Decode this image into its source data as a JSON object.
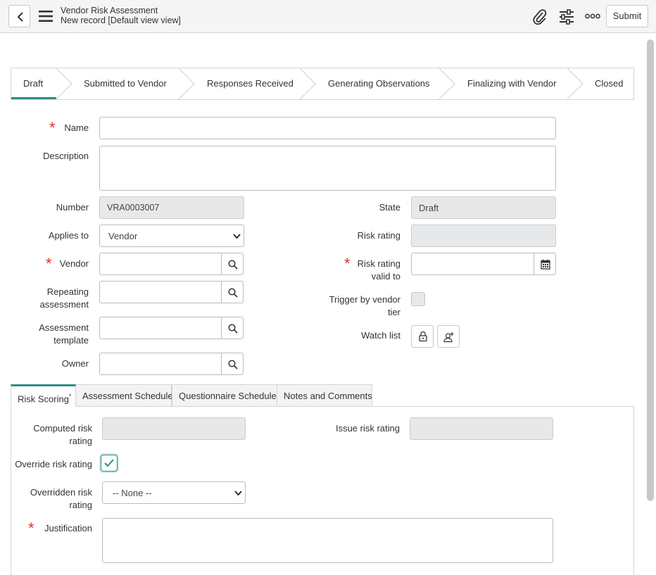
{
  "header": {
    "title": "Vendor Risk Assessment",
    "subtitle": "New record [Default view view]",
    "submit_label": "Submit"
  },
  "flow": [
    "Draft",
    "Submitted to Vendor",
    "Responses Received",
    "Generating Observations",
    "Finalizing with Vendor",
    "Closed"
  ],
  "form": {
    "name_label": "Name",
    "description_label": "Description",
    "number_label": "Number",
    "number_value": "VRA0003007",
    "applies_to_label": "Applies to",
    "applies_to_value": "Vendor",
    "vendor_label": "Vendor",
    "repeating_label_1": "Repeating",
    "repeating_label_2": "assessment",
    "template_label_1": "Assessment",
    "template_label_2": "template",
    "owner_label": "Owner",
    "state_label": "State",
    "state_value": "Draft",
    "risk_rating_label": "Risk rating",
    "risk_valid_label_1": "Risk rating",
    "risk_valid_label_2": "valid to",
    "trigger_label_1": "Trigger by vendor",
    "trigger_label_2": "tier",
    "watch_list_label": "Watch list"
  },
  "tabs": [
    "Risk Scoring",
    "Assessment Schedule",
    "Questionnaire Schedule",
    "Notes and Comments"
  ],
  "tab_marker": "*",
  "scoring": {
    "computed_label_1": "Computed risk",
    "computed_label_2": "rating",
    "issue_label": "Issue risk rating",
    "override_label": "Override risk rating",
    "override_checked": true,
    "overridden_label_1": "Overridden risk",
    "overridden_label_2": "rating",
    "overridden_value": "-- None --",
    "justification_label": "Justification"
  },
  "colors": {
    "accent": "#2f8f83",
    "required": "#e0352b"
  }
}
